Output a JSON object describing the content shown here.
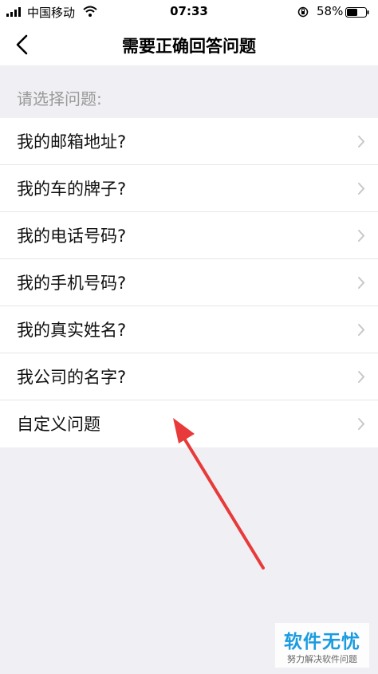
{
  "status_bar": {
    "carrier": "中国移动",
    "time": "07:33",
    "battery_percent": "58%",
    "icons": [
      "signal-icon",
      "wifi-icon",
      "orientation-lock-icon",
      "battery-icon"
    ]
  },
  "nav": {
    "title": "需要正确回答问题",
    "back_icon": "chevron-left-icon"
  },
  "section": {
    "header": "请选择问题:"
  },
  "questions": [
    {
      "label": "我的邮箱地址?"
    },
    {
      "label": "我的车的牌子?"
    },
    {
      "label": "我的电话号码?"
    },
    {
      "label": "我的手机号码?"
    },
    {
      "label": "我的真实姓名?"
    },
    {
      "label": "我公司的名字?"
    },
    {
      "label": "自定义问题"
    }
  ],
  "annotation": {
    "color": "#e83a3a"
  },
  "watermark": {
    "title": "软件无忧",
    "subtitle": "努力解决软件问题"
  },
  "colors": {
    "background": "#efeff4",
    "accent_watermark": "#1b9be0"
  }
}
